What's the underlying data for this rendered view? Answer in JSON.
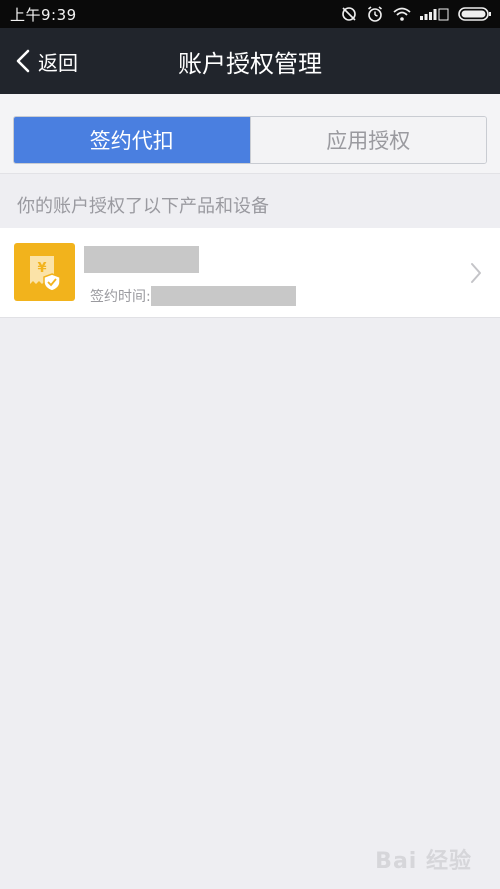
{
  "status_bar": {
    "time": "上午9:39"
  },
  "nav": {
    "back_label": "返回",
    "title": "账户授权管理"
  },
  "segments": {
    "tabs": [
      {
        "label": "签约代扣",
        "active": true
      },
      {
        "label": "应用授权",
        "active": false
      }
    ]
  },
  "section": {
    "label": "你的账户授权了以下产品和设备"
  },
  "list": {
    "items": [
      {
        "icon": "receipt-shield-icon",
        "sign_time_label": "签约时间:"
      }
    ]
  },
  "watermark": {
    "text": "Bai 经验"
  },
  "colors": {
    "nav_bg": "#21252c",
    "accent": "#4a7fe0",
    "icon_bg": "#f2b31c",
    "page_bg": "#eeeef2"
  }
}
